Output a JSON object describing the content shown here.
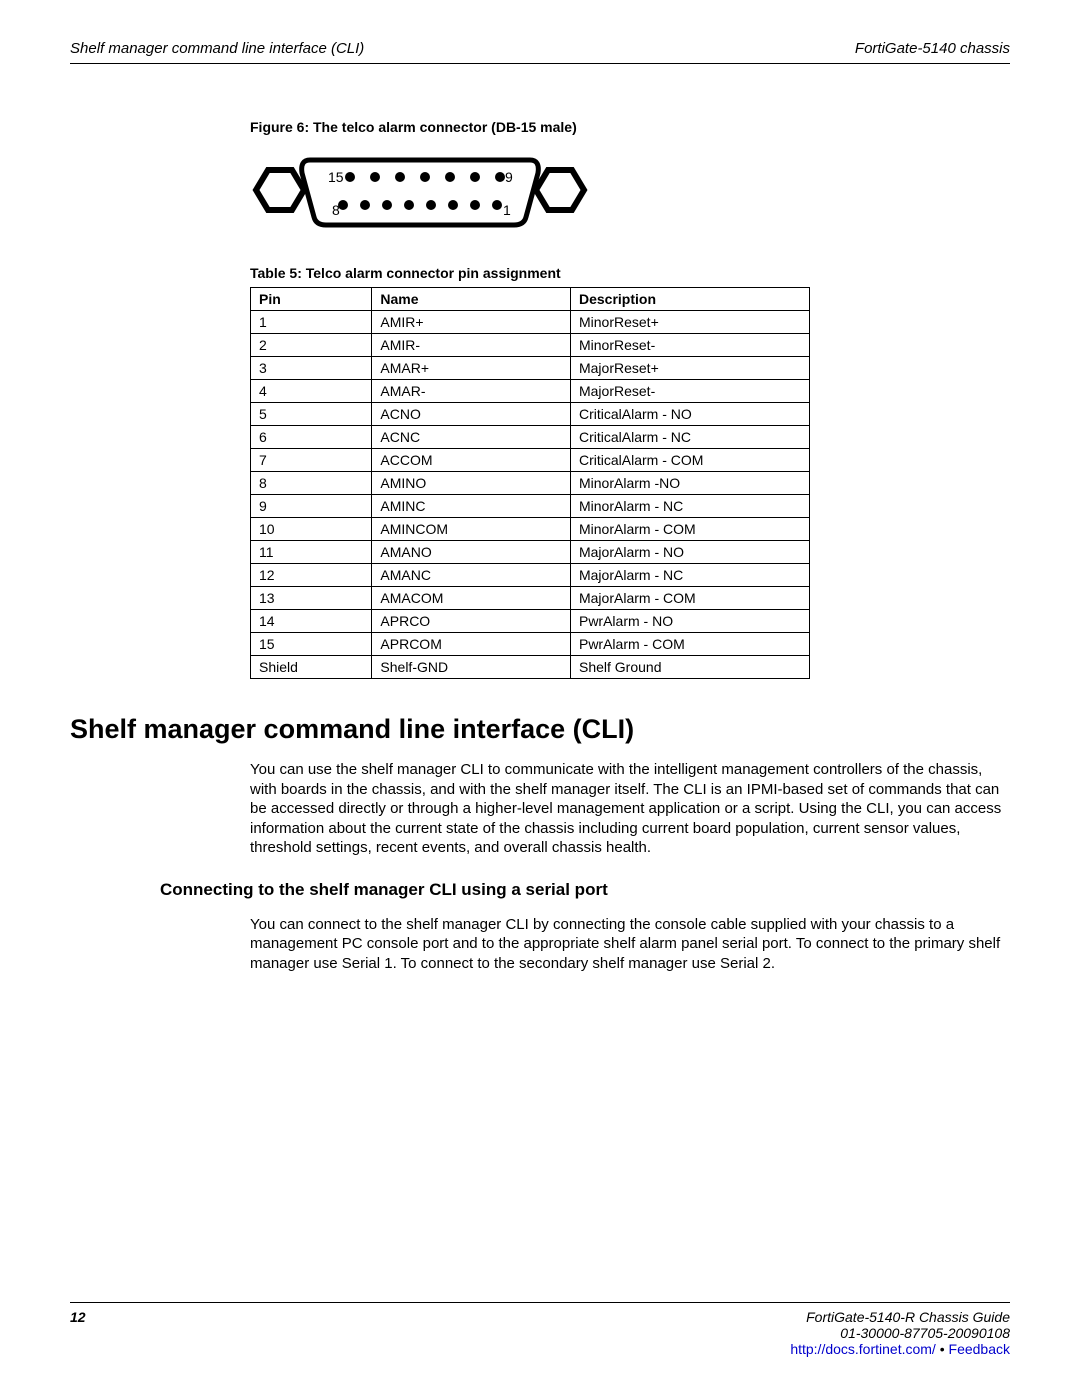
{
  "header": {
    "left": "Shelf manager command line interface (CLI)",
    "right": "FortiGate-5140 chassis"
  },
  "figure": {
    "caption": "Figure 6: The telco alarm connector (DB-15 male)",
    "top_left_num": "15",
    "top_right_num": "9",
    "bottom_left_num": "8",
    "bottom_right_num": "1"
  },
  "table": {
    "caption": "Table 5: Telco alarm connector pin assignment",
    "headers": {
      "pin": "Pin",
      "name": "Name",
      "desc": "Description"
    },
    "rows": [
      {
        "pin": "1",
        "name": "AMIR+",
        "desc": "MinorReset+"
      },
      {
        "pin": "2",
        "name": "AMIR-",
        "desc": "MinorReset-"
      },
      {
        "pin": "3",
        "name": "AMAR+",
        "desc": "MajorReset+"
      },
      {
        "pin": "4",
        "name": "AMAR-",
        "desc": "MajorReset-"
      },
      {
        "pin": "5",
        "name": "ACNO",
        "desc": "CriticalAlarm - NO"
      },
      {
        "pin": "6",
        "name": "ACNC",
        "desc": "CriticalAlarm - NC"
      },
      {
        "pin": "7",
        "name": "ACCOM",
        "desc": "CriticalAlarm - COM"
      },
      {
        "pin": "8",
        "name": "AMINO",
        "desc": "MinorAlarm -NO"
      },
      {
        "pin": "9",
        "name": "AMINC",
        "desc": "MinorAlarm - NC"
      },
      {
        "pin": "10",
        "name": "AMINCOM",
        "desc": "MinorAlarm - COM"
      },
      {
        "pin": "11",
        "name": "AMANO",
        "desc": "MajorAlarm - NO"
      },
      {
        "pin": "12",
        "name": "AMANC",
        "desc": "MajorAlarm - NC"
      },
      {
        "pin": "13",
        "name": "AMACOM",
        "desc": "MajorAlarm - COM"
      },
      {
        "pin": "14",
        "name": "APRCO",
        "desc": "PwrAlarm - NO"
      },
      {
        "pin": "15",
        "name": "APRCOM",
        "desc": "PwrAlarm - COM"
      },
      {
        "pin": "Shield",
        "name": "Shelf-GND",
        "desc": "Shelf Ground"
      }
    ]
  },
  "section": {
    "heading": "Shelf manager command line interface (CLI)",
    "p1": "You can use the shelf manager CLI to communicate with the intelligent management controllers of the chassis, with boards in the chassis, and with the shelf manager itself. The CLI is an IPMI-based set of commands that can be accessed directly or through a higher-level management application or a script. Using the CLI, you can access information about the current state of the chassis including current board population, current sensor values, threshold settings, recent events, and overall chassis health.",
    "sub_heading": "Connecting to the shelf manager CLI using a serial port",
    "p2": "You can connect to the shelf manager CLI by connecting the console cable supplied with your chassis to a management PC console port and to the appropriate shelf alarm panel serial port. To connect to the primary shelf manager use Serial 1. To connect to the secondary shelf manager use Serial 2."
  },
  "footer": {
    "page_num": "12",
    "guide": "FortiGate-5140-R   Chassis Guide",
    "rev": "01-30000-87705-20090108",
    "link": "http://docs.fortinet.com/",
    "sep": " • ",
    "feedback": "Feedback"
  }
}
